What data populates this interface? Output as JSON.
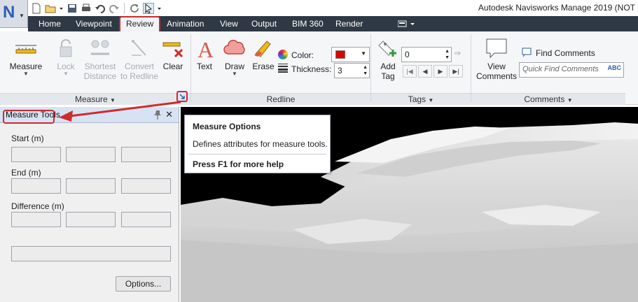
{
  "window": {
    "title": "Autodesk Navisworks Manage 2019 (NOT"
  },
  "app_menu": {
    "letter": "N"
  },
  "quick_access": {
    "icons": [
      "new-icon",
      "open-icon",
      "save-icon",
      "print-icon",
      "undo-icon",
      "redo-icon",
      "refresh-icon",
      "select-icon"
    ]
  },
  "tabs": [
    {
      "label": "Home"
    },
    {
      "label": "Viewpoint"
    },
    {
      "label": "Review",
      "active": true
    },
    {
      "label": "Animation"
    },
    {
      "label": "View"
    },
    {
      "label": "Output"
    },
    {
      "label": "BIM 360"
    },
    {
      "label": "Render"
    }
  ],
  "ribbon": {
    "measure_panel": {
      "title": "Measure",
      "buttons": [
        {
          "label": "Measure",
          "enabled": true
        },
        {
          "label": "Lock",
          "enabled": false
        },
        {
          "label_1": "Shortest",
          "label_2": "Distance",
          "enabled": false
        },
        {
          "label_1": "Convert",
          "label_2": "to Redline",
          "enabled": false
        },
        {
          "label": "Clear",
          "enabled": true
        }
      ]
    },
    "redline_panel": {
      "title": "Redline",
      "text_label": "Text",
      "draw_label": "Draw",
      "erase_label": "Erase",
      "color_label": "Color:",
      "color_value": "#e00000",
      "thickness_label": "Thickness:",
      "thickness_value": "3"
    },
    "tags_panel": {
      "title": "Tags",
      "add_tag_label_1": "Add",
      "add_tag_label_2": "Tag",
      "tag_number": "0"
    },
    "comments_panel": {
      "title": "Comments",
      "view_comments_1": "View",
      "view_comments_2": "Comments",
      "find_comments": "Find Comments",
      "quick_find_placeholder": "Quick Find Comments"
    }
  },
  "measure_tools": {
    "title": "Measure Tools",
    "start_label": "Start (m)",
    "end_label": "End (m)",
    "difference_label": "Difference (m)",
    "options_button": "Options..."
  },
  "tooltip": {
    "title": "Measure Options",
    "description": "Defines attributes for measure tools.",
    "help": "Press F1 for more help"
  },
  "colors": {
    "accent_red": "#d02a2a",
    "tab_bar": "#2f3845",
    "viewport": "#000000"
  }
}
